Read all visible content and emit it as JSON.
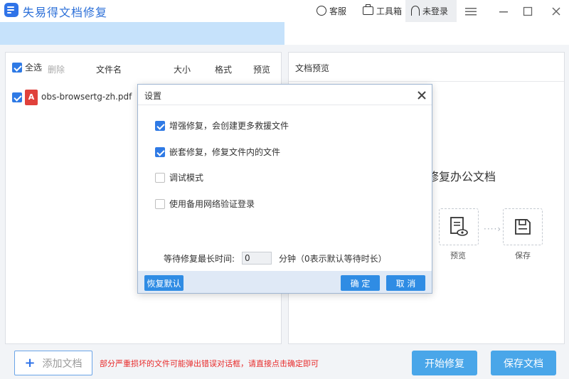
{
  "app": {
    "title": "失易得文档修复",
    "brand_color": "#2f73e8"
  },
  "titlebar": {
    "service_label": "客服",
    "toolbox_label": "工具箱",
    "user_label": "未登录",
    "menu_icon": "hamburger-icon",
    "minimize_icon": "minimize-icon",
    "maximize_icon": "maximize-icon",
    "close_icon": "close-icon"
  },
  "progress": {
    "fraction": 0.5,
    "fill_color": "#c6e2fb"
  },
  "file_list": {
    "select_all_label": "全选",
    "delete_label": "删除",
    "columns": [
      "文件名",
      "大小",
      "格式",
      "预览"
    ],
    "rows": [
      {
        "checked": true,
        "icon": "pdf-icon",
        "name": "obs-browsertg-zh.pdf"
      }
    ]
  },
  "preview": {
    "title": "文档预览",
    "heading": "修复办公文档",
    "steps": [
      {
        "icon": "preview-doc-icon",
        "label": "预览"
      },
      {
        "icon": "save-disk-icon",
        "label": "保存"
      }
    ]
  },
  "dialog": {
    "title": "设置",
    "options": [
      {
        "label": "增强修复，会创建更多救援文件",
        "checked": true
      },
      {
        "label": "嵌套修复，修复文件内的文件",
        "checked": true
      },
      {
        "label": "调试模式",
        "checked": false
      },
      {
        "label": "使用备用网络验证登录",
        "checked": false
      }
    ],
    "wait_label": "等待修复最长时间:",
    "wait_value": "0",
    "wait_suffix": "分钟（0表示默认等待时长）",
    "restore_default_label": "恢复默认",
    "ok_label": "确 定",
    "cancel_label": "取 消"
  },
  "bottom": {
    "add_label": "添加文档",
    "warning": "部分严重损坏的文件可能弹出错误对话框，请直接点击确定即可",
    "start_label": "开始修复",
    "save_label": "保存文档",
    "warning_color": "#e82b2b",
    "button_color": "#49a6e9"
  }
}
